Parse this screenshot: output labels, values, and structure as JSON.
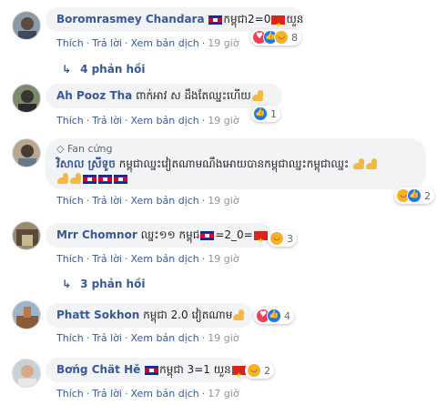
{
  "comments": [
    {
      "author": "Boromrasmey Chandara",
      "text_parts": [
        "កម្ពុជា2=0",
        "យួន"
      ],
      "reactions": [
        "love",
        "like",
        "haha"
      ],
      "reaction_count": "8",
      "action_like": "Thích",
      "action_reply": "Trả lời",
      "action_translate": "Xem bản dịch",
      "time": "19 giờ",
      "replies": "4 phản hồi"
    },
    {
      "author": "Ah Pooz Tha",
      "text": "ពាក់អាវ ស ដឹងតែឈ្នះហើយ",
      "reactions": [
        "like"
      ],
      "reaction_count": "1",
      "action_like": "Thích",
      "action_reply": "Trả lời",
      "action_translate": "Xem bản dịch",
      "time": "19 giờ"
    },
    {
      "fan_badge": "Fan cứng",
      "author": "វិសាល ស្រីទូច",
      "text": "កម្ពុជាឈ្នះវៀតណាមណឹងអោយបានកម្ពុជាឈ្នះកម្ពុជាឈ្នះ",
      "reactions": [
        "haha",
        "like"
      ],
      "reaction_count": "2",
      "action_like": "Thích",
      "action_reply": "Trả lời",
      "action_translate": "Xem bản dịch",
      "time": "19 giờ"
    },
    {
      "author": "Mrr Chomnor",
      "text_parts": [
        "ឈ្នះ១១ កម្ពុជ",
        "=2_0="
      ],
      "reactions": [
        "haha"
      ],
      "reaction_count": "3",
      "action_like": "Thích",
      "action_reply": "Trả lời",
      "action_translate": "Xem bản dịch",
      "time": "19 giờ",
      "replies": "3 phản hồi"
    },
    {
      "author": "Phatt Sokhon",
      "text": "កម្ពុជា 2.0 វៀតណាម",
      "reactions": [
        "love",
        "like"
      ],
      "reaction_count": "4",
      "action_like": "Thích",
      "action_reply": "Trả lời",
      "action_translate": "Xem bản dịch",
      "time": "19 giờ"
    },
    {
      "author": "Bơńg Chät Hě",
      "text_parts": [
        "កម្ពុជា 3=1 យួន"
      ],
      "reactions": [
        "haha"
      ],
      "reaction_count": "2",
      "action_like": "Thích",
      "action_reply": "Trả lời",
      "action_translate": "Xem bản dịch",
      "time": "17 giờ"
    }
  ],
  "colors": {
    "link": "#385898",
    "bubble": "#f2f3f5",
    "meta": "#606770",
    "like": "#1877f2",
    "love": "#f33e58",
    "haha": "#f7b125"
  }
}
